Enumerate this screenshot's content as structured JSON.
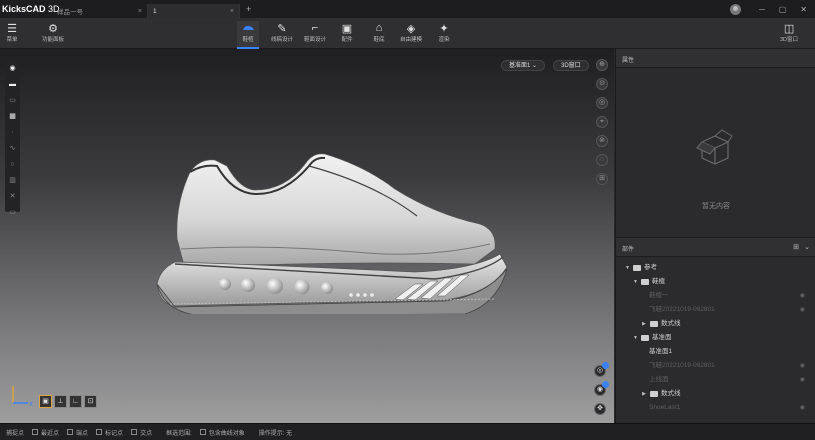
{
  "titlebar": {
    "brand": "KicksCAD",
    "brand_suffix": " 3D",
    "tabs": [
      {
        "label": "样品一号"
      },
      {
        "label": "1"
      }
    ],
    "new_tab": "+",
    "controls": {
      "minimize": "─",
      "maximize": "▢",
      "close": "✕"
    }
  },
  "toolbar": {
    "left": [
      {
        "label": "菜单",
        "icon": "menu-icon"
      },
      {
        "label": "功能面板",
        "icon": "panel-icon"
      }
    ],
    "tools": [
      {
        "label": "鞋楦",
        "icon": "last-icon",
        "active": true
      },
      {
        "label": "线稿设计",
        "icon": "pen-icon"
      },
      {
        "label": "鞋面设计",
        "icon": "upper-icon"
      },
      {
        "label": "配件",
        "icon": "accessory-icon"
      },
      {
        "label": "鞋底",
        "icon": "sole-icon"
      },
      {
        "label": "自由建模",
        "icon": "cube-icon"
      },
      {
        "label": "渲染",
        "icon": "render-icon"
      }
    ],
    "right": {
      "label": "3D窗口",
      "icon": "window-icon"
    }
  },
  "viewport": {
    "plane_select": "基准面1",
    "window_button": "3D窗口",
    "axis_labels": {
      "x": "X",
      "z": "Z"
    }
  },
  "right_panel": {
    "properties_title": "属性",
    "empty_text": "暂无内容",
    "parts_title": "部件",
    "tree": [
      {
        "label": "参考",
        "level": 0,
        "type": "folder",
        "expanded": true
      },
      {
        "label": "鞋楦",
        "level": 1,
        "type": "folder",
        "expanded": true
      },
      {
        "label": "鞋楦一",
        "level": 2,
        "type": "item",
        "dim": true,
        "eye": true
      },
      {
        "label": "飞鞋20221019-092801",
        "level": 2,
        "type": "item",
        "dim": true,
        "eye": true
      },
      {
        "label": "数式线",
        "level": 2,
        "type": "folder",
        "expanded": false
      },
      {
        "label": "基准面",
        "level": 1,
        "type": "folder",
        "expanded": true
      },
      {
        "label": "基准面1",
        "level": 2,
        "type": "item",
        "dim": false,
        "eye": false
      },
      {
        "label": "飞鞋20221019-092801",
        "level": 2,
        "type": "item",
        "dim": true,
        "eye": true
      },
      {
        "label": "上线面",
        "level": 2,
        "type": "item",
        "dim": true,
        "eye": true
      },
      {
        "label": "数式线",
        "level": 2,
        "type": "folder",
        "expanded": false
      },
      {
        "label": "ShoeLast1",
        "level": 2,
        "type": "item",
        "dim": true,
        "eye": true
      }
    ]
  },
  "statusbar": {
    "snap_label": "捕捉点",
    "snaps": [
      "最近点",
      "端点",
      "标记点",
      "交点"
    ],
    "select_label": "框选范围:",
    "select_option": "包含曲线对象",
    "hint_label": "操作提示:",
    "hint_value": "无"
  },
  "colors": {
    "accent": "#3b82f6",
    "background": "#2b2b2d",
    "selected_view": "#d9a441"
  }
}
